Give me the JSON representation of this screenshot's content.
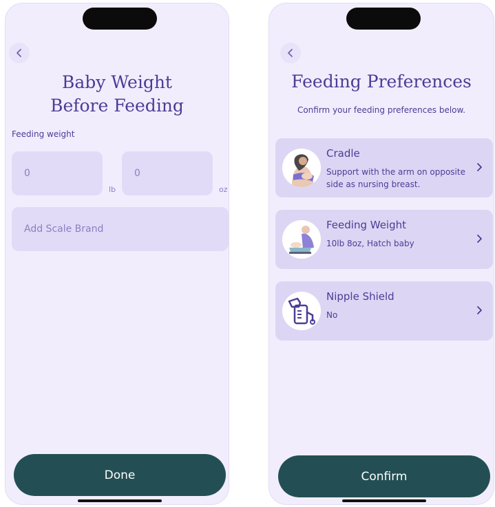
{
  "left": {
    "title": "Baby Weight Before Feeding",
    "field_label": "Feeding weight",
    "lb_value": "0",
    "lb_unit": "lb",
    "oz_value": "0",
    "oz_unit": "oz",
    "scale_placeholder": "Add Scale Brand",
    "done_label": "Done"
  },
  "right": {
    "title": "Feeding Preferences",
    "subtitle": "Confirm your feeding preferences below.",
    "cards": [
      {
        "title": "Cradle",
        "description": "Support with the arm on opposite side as nursing breast.",
        "icon": "cradle-illustration"
      },
      {
        "title": "Feeding Weight",
        "description": "10lb 8oz, Hatch baby",
        "icon": "baby-scale-illustration"
      },
      {
        "title": "Nipple Shield",
        "description": "No",
        "icon": "breast-pump-icon"
      }
    ],
    "confirm_label": "Confirm"
  },
  "colors": {
    "background": "#f1edfd",
    "accent": "#4c3c96",
    "field": "#e2dbf7",
    "card": "#dcd6f4",
    "button": "#234f54"
  }
}
